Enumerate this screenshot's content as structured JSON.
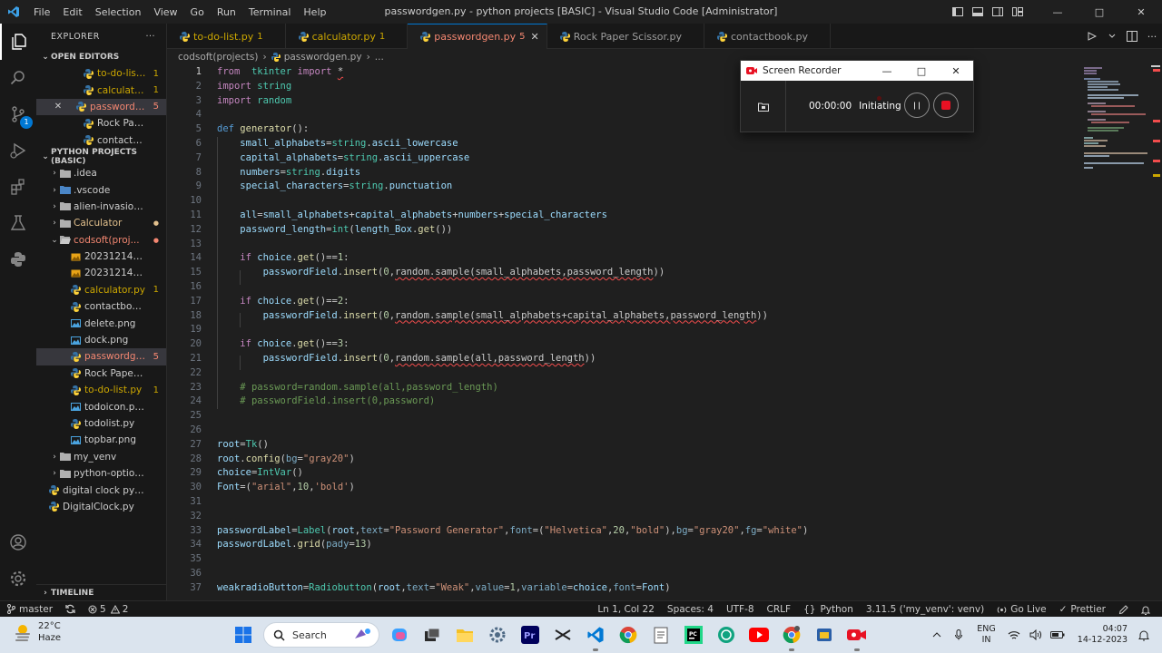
{
  "window": {
    "title": "passwordgen.py - python projects [BASIC] - Visual Studio Code [Administrator]",
    "menu": [
      "File",
      "Edit",
      "Selection",
      "View",
      "Go",
      "Run",
      "Terminal",
      "Help"
    ]
  },
  "sidebar": {
    "header": "EXPLORER",
    "more": "···",
    "open_editors_title": "OPEN EDITORS",
    "open_editors": [
      {
        "name": "to-do-list.py...",
        "count": "1",
        "cls": "warn",
        "icon": "python-icon"
      },
      {
        "name": "calculator.p...",
        "count": "1",
        "cls": "warn",
        "icon": "python-icon"
      },
      {
        "name": "passwordge...",
        "count": "5",
        "cls": "err",
        "icon": "python-icon",
        "selected": true
      },
      {
        "name": "Rock Paper Sciss...",
        "count": "",
        "cls": "",
        "icon": "python-icon"
      },
      {
        "name": "contactbook.py...",
        "count": "",
        "cls": "",
        "icon": "python-icon"
      }
    ],
    "project_title": "PYTHON PROJECTS (BASIC)",
    "tree": [
      {
        "name": ".idea",
        "type": "folder",
        "level": 1,
        "chev": "›",
        "count": "",
        "cls": ""
      },
      {
        "name": ".vscode",
        "type": "folder-blue",
        "level": 1,
        "chev": "›",
        "count": "",
        "cls": ""
      },
      {
        "name": "alien-invasion-ga...",
        "type": "folder",
        "level": 1,
        "chev": "›",
        "count": "",
        "cls": ""
      },
      {
        "name": "Calculator",
        "type": "folder",
        "level": 1,
        "chev": "›",
        "count": "●",
        "cls": "mod"
      },
      {
        "name": "codsoft(proj...",
        "type": "folder-open",
        "level": 1,
        "chev": "⌄",
        "count": "●",
        "cls": "err"
      },
      {
        "name": "2023121416020...",
        "type": "img",
        "level": 2,
        "chev": "",
        "count": "",
        "cls": ""
      },
      {
        "name": "2023121416050...",
        "type": "img",
        "level": 2,
        "chev": "",
        "count": "",
        "cls": ""
      },
      {
        "name": "calculator.py",
        "type": "py",
        "level": 2,
        "chev": "",
        "count": "1",
        "cls": "warn"
      },
      {
        "name": "contactbook.py",
        "type": "py",
        "level": 2,
        "chev": "",
        "count": "",
        "cls": ""
      },
      {
        "name": "delete.png",
        "type": "png",
        "level": 2,
        "chev": "",
        "count": "",
        "cls": ""
      },
      {
        "name": "dock.png",
        "type": "png",
        "level": 2,
        "chev": "",
        "count": "",
        "cls": ""
      },
      {
        "name": "passwordge...",
        "type": "py",
        "level": 2,
        "chev": "",
        "count": "5",
        "cls": "err",
        "selected": true
      },
      {
        "name": "Rock Paper Sciss...",
        "type": "py",
        "level": 2,
        "chev": "",
        "count": "",
        "cls": ""
      },
      {
        "name": "to-do-list.py",
        "type": "py",
        "level": 2,
        "chev": "",
        "count": "1",
        "cls": "warn"
      },
      {
        "name": "todoicon.png",
        "type": "png",
        "level": 2,
        "chev": "",
        "count": "",
        "cls": ""
      },
      {
        "name": "todolist.py",
        "type": "py",
        "level": 2,
        "chev": "",
        "count": "",
        "cls": ""
      },
      {
        "name": "topbar.png",
        "type": "png",
        "level": 2,
        "chev": "",
        "count": "",
        "cls": ""
      },
      {
        "name": "my_venv",
        "type": "folder",
        "level": 1,
        "chev": "›",
        "count": "",
        "cls": ""
      },
      {
        "name": "python-option-cal...",
        "type": "folder",
        "level": 1,
        "chev": "›",
        "count": "",
        "cls": ""
      },
      {
        "name": "digital clock pytho...",
        "type": "py",
        "level": 1,
        "chev": "",
        "count": "",
        "cls": ""
      },
      {
        "name": "DigitalClock.py",
        "type": "py",
        "level": 1,
        "chev": "",
        "count": "",
        "cls": ""
      }
    ],
    "timeline": "TIMELINE"
  },
  "tabs": [
    {
      "name": "to-do-list.py",
      "badge": "1",
      "cls": "warn",
      "active": false
    },
    {
      "name": "calculator.py",
      "badge": "1",
      "cls": "warn",
      "active": false
    },
    {
      "name": "passwordgen.py",
      "badge": "5",
      "cls": "err",
      "active": true
    },
    {
      "name": "Rock Paper Scissor.py",
      "badge": "",
      "cls": "",
      "active": false
    },
    {
      "name": "contactbook.py",
      "badge": "",
      "cls": "",
      "active": false
    }
  ],
  "breadcrumb": {
    "folder": "codsoft(projects)",
    "file": "passwordgen.py",
    "more": "..."
  },
  "editor": {
    "line_numbers": [
      "1",
      "2",
      "3",
      "4",
      "5",
      "6",
      "7",
      "8",
      "9",
      "10",
      "11",
      "12",
      "13",
      "14",
      "15",
      "16",
      "17",
      "18",
      "19",
      "20",
      "21",
      "22",
      "23",
      "24",
      "25",
      "26",
      "27",
      "28",
      "29",
      "30",
      "31",
      "32",
      "33",
      "34",
      "35",
      "36",
      "37"
    ],
    "lines": [
      [
        [
          "kw",
          "from"
        ],
        [
          "",
          "  "
        ],
        [
          "cls",
          "tkinter"
        ],
        [
          "",
          " "
        ],
        [
          "kw",
          "import"
        ],
        [
          "",
          " "
        ],
        [
          "sq",
          "*"
        ]
      ],
      [
        [
          "kw",
          "import"
        ],
        [
          "",
          " "
        ],
        [
          "cls",
          "string"
        ]
      ],
      [
        [
          "kw",
          "import"
        ],
        [
          "",
          " "
        ],
        [
          "cls",
          "random"
        ]
      ],
      [],
      [
        [
          "kw2",
          "def"
        ],
        [
          "",
          " "
        ],
        [
          "fn",
          "generator"
        ],
        [
          "",
          "():"
        ]
      ],
      [
        [
          "",
          "    "
        ],
        [
          "var",
          "small_alphabets"
        ],
        [
          "",
          "="
        ],
        [
          "cls",
          "string"
        ],
        [
          "",
          "."
        ],
        [
          "var",
          "ascii_lowercase"
        ]
      ],
      [
        [
          "",
          "    "
        ],
        [
          "var",
          "capital_alphabets"
        ],
        [
          "",
          "="
        ],
        [
          "cls",
          "string"
        ],
        [
          "",
          "."
        ],
        [
          "var",
          "ascii_uppercase"
        ]
      ],
      [
        [
          "",
          "    "
        ],
        [
          "var",
          "numbers"
        ],
        [
          "",
          "="
        ],
        [
          "cls",
          "string"
        ],
        [
          "",
          "."
        ],
        [
          "var",
          "digits"
        ]
      ],
      [
        [
          "",
          "    "
        ],
        [
          "var",
          "special_characters"
        ],
        [
          "",
          "="
        ],
        [
          "cls",
          "string"
        ],
        [
          "",
          "."
        ],
        [
          "var",
          "punctuation"
        ]
      ],
      [],
      [
        [
          "",
          "    "
        ],
        [
          "var",
          "all"
        ],
        [
          "",
          "="
        ],
        [
          "var",
          "small_alphabets"
        ],
        [
          "",
          "+"
        ],
        [
          "var",
          "capital_alphabets"
        ],
        [
          "",
          "+"
        ],
        [
          "var",
          "numbers"
        ],
        [
          "",
          "+"
        ],
        [
          "var",
          "special_characters"
        ]
      ],
      [
        [
          "",
          "    "
        ],
        [
          "var",
          "password_length"
        ],
        [
          "",
          "="
        ],
        [
          "cls",
          "int"
        ],
        [
          "",
          "("
        ],
        [
          "var",
          "length_Box"
        ],
        [
          "",
          "."
        ],
        [
          "fn",
          "get"
        ],
        [
          "",
          "())"
        ]
      ],
      [],
      [
        [
          "",
          "    "
        ],
        [
          "kw",
          "if"
        ],
        [
          "",
          " "
        ],
        [
          "var",
          "choice"
        ],
        [
          "",
          "."
        ],
        [
          "fn",
          "get"
        ],
        [
          "",
          "()=="
        ],
        [
          "num",
          "1"
        ],
        [
          "",
          ":"
        ]
      ],
      [
        [
          "",
          "        "
        ],
        [
          "var",
          "passwordField"
        ],
        [
          "",
          "."
        ],
        [
          "fn",
          "insert"
        ],
        [
          "",
          "("
        ],
        [
          "num",
          "0"
        ],
        [
          "",
          ","
        ],
        [
          "sq",
          "random.sample(small_alphabets,password_length"
        ],
        [
          "",
          "))"
        ]
      ],
      [],
      [
        [
          "",
          "    "
        ],
        [
          "kw",
          "if"
        ],
        [
          "",
          " "
        ],
        [
          "var",
          "choice"
        ],
        [
          "",
          "."
        ],
        [
          "fn",
          "get"
        ],
        [
          "",
          "()=="
        ],
        [
          "num",
          "2"
        ],
        [
          "",
          ":"
        ]
      ],
      [
        [
          "",
          "        "
        ],
        [
          "var",
          "passwordField"
        ],
        [
          "",
          "."
        ],
        [
          "fn",
          "insert"
        ],
        [
          "",
          "("
        ],
        [
          "num",
          "0"
        ],
        [
          "",
          ","
        ],
        [
          "sq",
          "random.sample(small_alphabets+capital_alphabets,password_length"
        ],
        [
          "",
          "))"
        ]
      ],
      [],
      [
        [
          "",
          "    "
        ],
        [
          "kw",
          "if"
        ],
        [
          "",
          " "
        ],
        [
          "var",
          "choice"
        ],
        [
          "",
          "."
        ],
        [
          "fn",
          "get"
        ],
        [
          "",
          "()=="
        ],
        [
          "num",
          "3"
        ],
        [
          "",
          ":"
        ]
      ],
      [
        [
          "",
          "        "
        ],
        [
          "var",
          "passwordField"
        ],
        [
          "",
          "."
        ],
        [
          "fn",
          "insert"
        ],
        [
          "",
          "("
        ],
        [
          "num",
          "0"
        ],
        [
          "",
          ","
        ],
        [
          "sq",
          "random.sample(all,password_length"
        ],
        [
          "",
          "))"
        ]
      ],
      [],
      [
        [
          "",
          "    "
        ],
        [
          "com",
          "# password=random.sample(all,password_length)"
        ]
      ],
      [
        [
          "",
          "    "
        ],
        [
          "com",
          "# passwordField.insert(0,password)"
        ]
      ],
      [],
      [],
      [
        [
          "var",
          "root"
        ],
        [
          "",
          "="
        ],
        [
          "cls",
          "Tk"
        ],
        [
          "",
          "()"
        ]
      ],
      [
        [
          "var",
          "root"
        ],
        [
          "",
          "."
        ],
        [
          "fn",
          "config"
        ],
        [
          "",
          "("
        ],
        [
          "prm",
          "bg"
        ],
        [
          "",
          "="
        ],
        [
          "str",
          "\"gray20\""
        ],
        [
          "",
          ")"
        ]
      ],
      [
        [
          "var",
          "choice"
        ],
        [
          "",
          "="
        ],
        [
          "cls",
          "IntVar"
        ],
        [
          "",
          "()"
        ]
      ],
      [
        [
          "var",
          "Font"
        ],
        [
          "",
          "=("
        ],
        [
          "str",
          "\"arial\""
        ],
        [
          "",
          ","
        ],
        [
          "num",
          "10"
        ],
        [
          "",
          ","
        ],
        [
          "str",
          "'bold'"
        ],
        [
          "",
          ")"
        ]
      ],
      [],
      [],
      [
        [
          "var",
          "passwordLabel"
        ],
        [
          "",
          "="
        ],
        [
          "cls",
          "Label"
        ],
        [
          "",
          "("
        ],
        [
          "var",
          "root"
        ],
        [
          "",
          ","
        ],
        [
          "prm",
          "text"
        ],
        [
          "",
          "="
        ],
        [
          "str",
          "\"Password Generator\""
        ],
        [
          "",
          ","
        ],
        [
          "prm",
          "font"
        ],
        [
          "",
          "=("
        ],
        [
          "str",
          "\"Helvetica\""
        ],
        [
          "",
          ","
        ],
        [
          "num",
          "20"
        ],
        [
          "",
          ","
        ],
        [
          "str",
          "\"bold\""
        ],
        [
          "",
          "),"
        ],
        [
          "prm",
          "bg"
        ],
        [
          "",
          "="
        ],
        [
          "str",
          "\"gray20\""
        ],
        [
          "",
          ","
        ],
        [
          "prm",
          "fg"
        ],
        [
          "",
          "="
        ],
        [
          "str",
          "\"white\""
        ],
        [
          "",
          ")"
        ]
      ],
      [
        [
          "var",
          "passwordLabel"
        ],
        [
          "",
          "."
        ],
        [
          "fn",
          "grid"
        ],
        [
          "",
          "("
        ],
        [
          "prm",
          "pady"
        ],
        [
          "",
          "="
        ],
        [
          "num",
          "13"
        ],
        [
          "",
          ")"
        ]
      ],
      [],
      [],
      [
        [
          "var",
          "weakradioButton"
        ],
        [
          "",
          "="
        ],
        [
          "cls",
          "Radiobutton"
        ],
        [
          "",
          "("
        ],
        [
          "var",
          "root"
        ],
        [
          "",
          ","
        ],
        [
          "prm",
          "text"
        ],
        [
          "",
          "="
        ],
        [
          "str",
          "\"Weak\""
        ],
        [
          "",
          ","
        ],
        [
          "prm",
          "value"
        ],
        [
          "",
          "="
        ],
        [
          "num",
          "1"
        ],
        [
          "",
          ","
        ],
        [
          "prm",
          "variable"
        ],
        [
          "",
          "="
        ],
        [
          "var",
          "choice"
        ],
        [
          "",
          ","
        ],
        [
          "prm",
          "font"
        ],
        [
          "",
          "="
        ],
        [
          "var",
          "Font"
        ],
        [
          "",
          ")"
        ]
      ]
    ]
  },
  "recorder": {
    "title": "Screen Recorder",
    "time": "00:00:00",
    "status": "Initiating"
  },
  "statusbar": {
    "branch": "master",
    "errors": "5",
    "warnings": "2",
    "position": "Ln 1, Col 22",
    "spaces": "Spaces: 4",
    "encoding": "UTF-8",
    "eol": "CRLF",
    "language": "Python",
    "interpreter": "3.11.5 ('my_venv': venv)",
    "golive": "Go Live",
    "prettier": "Prettier"
  },
  "taskbar": {
    "temp": "22°C",
    "weather": "Haze",
    "search": "Search",
    "lang1": "ENG",
    "lang2": "IN",
    "time": "04:07",
    "date": "14-12-2023"
  },
  "colors": {
    "accent": "#0078d4",
    "error": "#f48771",
    "warning": "#cca700"
  }
}
